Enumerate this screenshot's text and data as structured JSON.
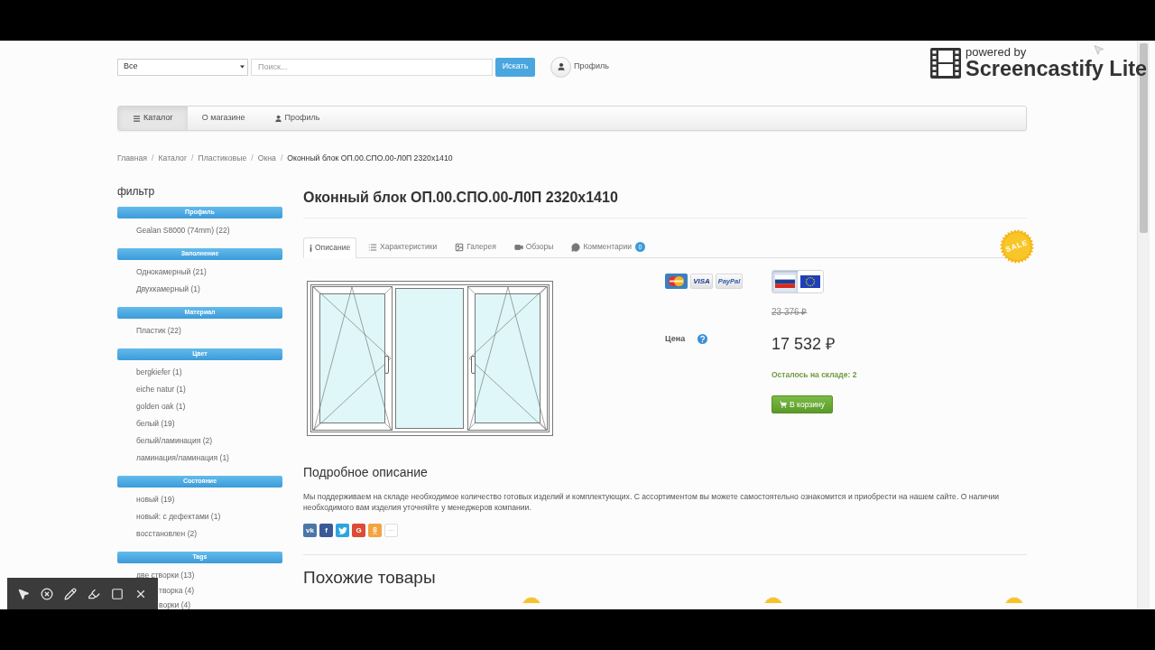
{
  "search_bar": {
    "category": "Все",
    "placeholder": "Поиск...",
    "button": "Искать",
    "profile_link": "Профиль"
  },
  "recorder_overlay": {
    "tagline": "powered by",
    "name": "Screencastify Lite"
  },
  "nav": [
    {
      "label": "Каталог",
      "selected": true
    },
    {
      "label": "О магазине",
      "selected": false
    },
    {
      "label": "Профиль",
      "selected": false
    }
  ],
  "breadcrumbs": [
    {
      "kind": "link",
      "text": "Главная"
    },
    {
      "kind": "separator",
      "text": "/"
    },
    {
      "kind": "link",
      "text": "Каталог"
    },
    {
      "kind": "separator",
      "text": "/"
    },
    {
      "kind": "link",
      "text": "Пластиковые"
    },
    {
      "kind": "separator",
      "text": "/"
    },
    {
      "kind": "link",
      "text": "Окна"
    },
    {
      "kind": "separator",
      "text": "/"
    },
    {
      "kind": "current",
      "text": "Оконный блок ОП.00.СПО.00-Л0П 2320x1410"
    }
  ],
  "filter": {
    "title": "фильтр",
    "groups": [
      {
        "title": "Профиль",
        "items": [
          {
            "kind": "option",
            "label": "Gealan S8000 (74mm) (22)"
          }
        ]
      },
      {
        "title": "Заполнение",
        "items": [
          {
            "kind": "option",
            "label": "Однокамерный (21)"
          },
          {
            "kind": "option",
            "label": "Двухкамерный (1)"
          }
        ]
      },
      {
        "title": "Материал",
        "items": [
          {
            "kind": "option",
            "label": "Пластик (22)"
          }
        ]
      },
      {
        "title": "Цвет",
        "items": [
          {
            "kind": "option",
            "label": "bergkiefer (1)"
          },
          {
            "kind": "option",
            "label": "eiche natur (1)"
          },
          {
            "kind": "option",
            "label": "golden oak (1)"
          },
          {
            "kind": "option",
            "label": "белый (19)"
          },
          {
            "kind": "option",
            "label": "белый/ламинация (2)"
          },
          {
            "kind": "option",
            "label": "ламинация/ламинация (1)"
          }
        ]
      },
      {
        "title": "Состояние",
        "items": [
          {
            "kind": "option",
            "label": "новый (19)"
          },
          {
            "kind": "option",
            "label": "новый: с дефектами (1)"
          },
          {
            "kind": "option",
            "label": "восстановлен (2)"
          }
        ]
      },
      {
        "title": "Tags",
        "items": [
          {
            "kind": "option",
            "label": "две створки (13)"
          },
          {
            "kind": "partial",
            "label": "творка (4)"
          },
          {
            "kind": "partial",
            "label": "ворки (4)"
          }
        ]
      }
    ]
  },
  "product": {
    "title": "Оконный блок ОП.00.СПО.00-Л0П 2320x1410",
    "tabs": [
      {
        "label": "Описание",
        "selected": true
      },
      {
        "label": "Характеристики",
        "selected": false
      },
      {
        "label": "Галерея",
        "selected": false
      },
      {
        "label": "Обзоры",
        "selected": false
      },
      {
        "label": "Комментарии",
        "badge": "0",
        "selected": false
      }
    ],
    "sale_badge": "SALE",
    "payment_methods": [
      {
        "kind": "card"
      },
      {
        "kind": "visa",
        "label": "VISA"
      },
      {
        "kind": "paypal",
        "label": "PayPal"
      }
    ],
    "currencies": [
      {
        "kind": "tricolor",
        "selected": true
      },
      {
        "kind": "stars",
        "selected": false
      }
    ],
    "price_label": "Цена",
    "old_price": "23 376 ₽",
    "price": "17 532 ₽",
    "stock": "Осталось на складе: 2",
    "cart_button": "В корзину"
  },
  "description": {
    "heading": "Подробное описание",
    "text": "Мы поддерживаем на складе необходимое количество готовых изделий и комплектующих. С ассортиментом вы можете самостоятельно ознакомится и приобрести на нашем сайте. О наличии необходимого вам изделия уточняйте у менеджеров компании."
  },
  "share": [
    {
      "kind": "text",
      "label": "vk",
      "color": "#4a76a8"
    },
    {
      "kind": "text",
      "label": "f",
      "color": "#3b5998"
    },
    {
      "kind": "bird",
      "color": "#2ca5e0"
    },
    {
      "kind": "text",
      "label": "G",
      "color": "#dd4b39"
    },
    {
      "kind": "person",
      "color": "#f4a340"
    },
    {
      "kind": "more",
      "label": "···"
    }
  ],
  "similar": {
    "heading": "Похожие товары",
    "items": [
      {
        "sale": true
      },
      {
        "sale": true
      },
      {
        "sale": true
      }
    ]
  }
}
